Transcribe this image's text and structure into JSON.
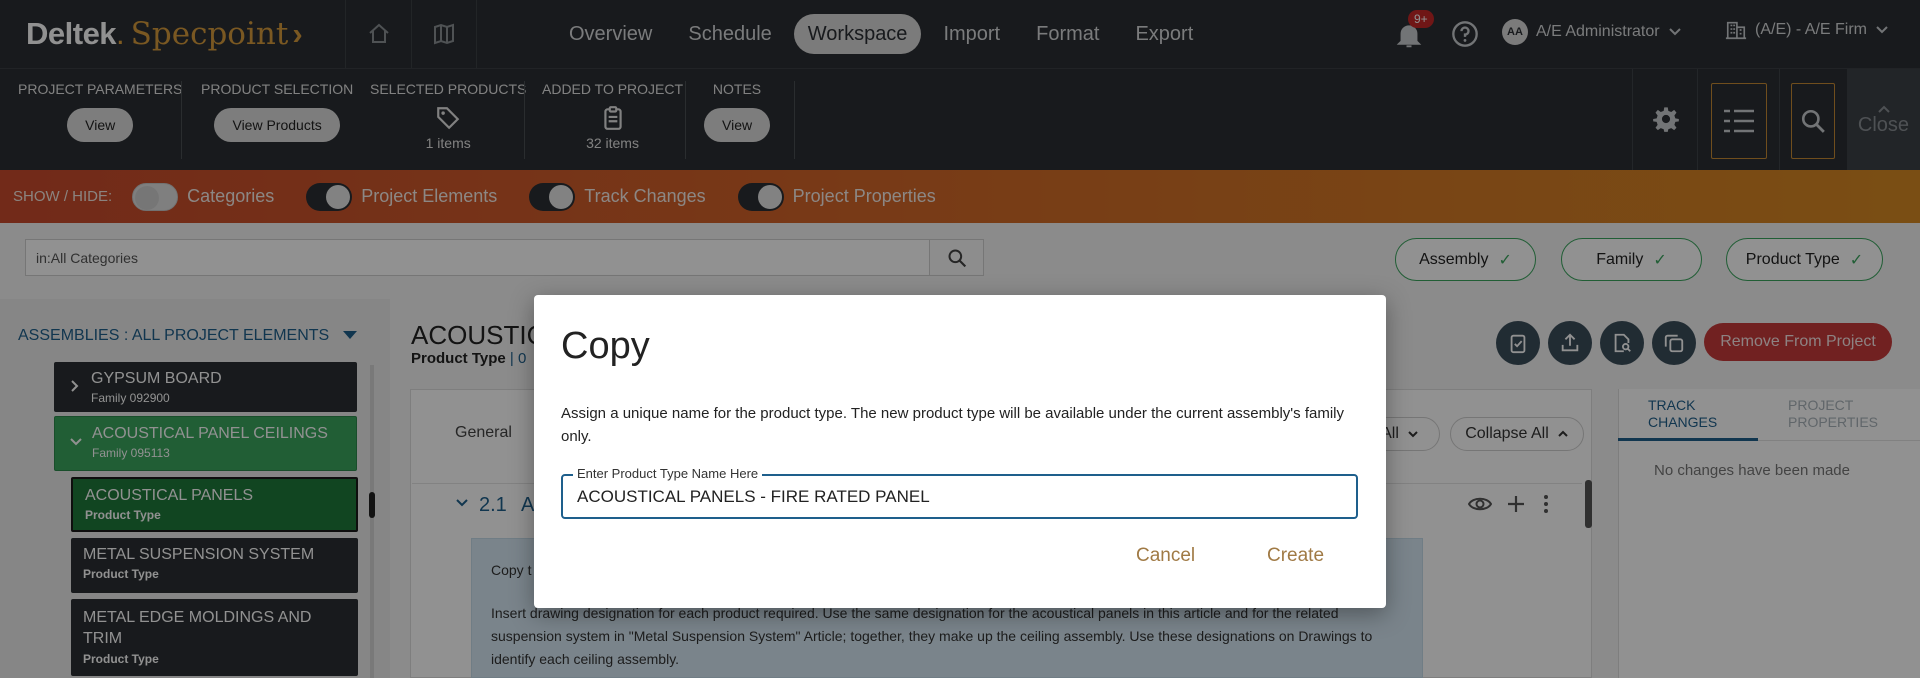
{
  "brand": {
    "name": "Deltek",
    "dot": ".",
    "product": "Specpoint",
    "chevron": "›"
  },
  "nav": {
    "home_icon": "home-icon",
    "map_icon": "map-icon",
    "links": [
      "Overview",
      "Schedule",
      "Workspace",
      "Import",
      "Format",
      "Export"
    ],
    "active": "Workspace",
    "notification_badge": "9+",
    "user_initials": "AA",
    "user_name": "A/E Administrator",
    "firm_name": "(A/E) - A/E Firm"
  },
  "toolbar": {
    "project_parameters": {
      "label": "PROJECT PARAMETERS",
      "button": "View"
    },
    "product_selection": {
      "label": "PRODUCT SELECTION",
      "button": "View Products"
    },
    "selected_products": {
      "label": "SELECTED PRODUCTS",
      "count": "1 items"
    },
    "added_to_project": {
      "label": "ADDED TO PROJECT",
      "count": "32 items"
    },
    "notes": {
      "label": "NOTES",
      "button": "View"
    },
    "close_label": "Close"
  },
  "show_hide": {
    "label": "SHOW / HIDE:",
    "toggles": [
      {
        "label": "Categories",
        "on": false
      },
      {
        "label": "Project Elements",
        "on": true
      },
      {
        "label": "Track Changes",
        "on": true
      },
      {
        "label": "Project Properties",
        "on": true
      }
    ]
  },
  "search": {
    "value": "in:All Categories"
  },
  "filters": [
    "Assembly",
    "Family",
    "Product Type"
  ],
  "assemblies": {
    "header": "ASSEMBLIES : ALL PROJECT ELEMENTS",
    "items": [
      {
        "name": "GYPSUM BOARD",
        "sub": "Family 092900"
      },
      {
        "name": "ACOUSTICAL PANEL CEILINGS",
        "sub": "Family 095113"
      },
      {
        "name": "ACOUSTICAL PANELS",
        "sub": "Product Type"
      },
      {
        "name": "METAL SUSPENSION SYSTEM",
        "sub": "Product Type"
      },
      {
        "name": "METAL EDGE MOLDINGS AND TRIM",
        "sub": "Product Type"
      }
    ]
  },
  "main": {
    "title": "ACOUSTIC",
    "subtitle": "Product Type",
    "subtitle_sep": "| 0",
    "remove_button": "Remove From Project",
    "tab_general": "General",
    "expand_all": "All",
    "collapse_all": "Collapse All",
    "article_number": "2.1",
    "article_letter": "A",
    "note_line1": "Copy t",
    "note_line2": "Insert drawing designation for each product required. Use the same designation for the acoustical panels in this article and for the related suspension system in \"Metal Suspension System\" Article; together, they make up the ceiling assembly. Use these designations on Drawings to identify each ceiling assembly."
  },
  "right_panel": {
    "tab_track_changes": "TRACK CHANGES",
    "tab_project_properties": "PROJECT PROPERTIES",
    "empty_text": "No changes have been made"
  },
  "modal": {
    "title": "Copy",
    "description": "Assign a unique name for the product type. The new product type will be available under the current assembly's family only.",
    "field_label": "Enter Product Type Name Here",
    "field_value": "ACOUSTICAL PANELS - FIRE RATED PANEL",
    "cancel": "Cancel",
    "create": "Create"
  },
  "colors": {
    "nav_bg": "#2b2f33",
    "accent_gold": "#d69b3c",
    "green": "#3aa55e",
    "red": "#c73a3a",
    "blue": "#1e5f8c"
  }
}
